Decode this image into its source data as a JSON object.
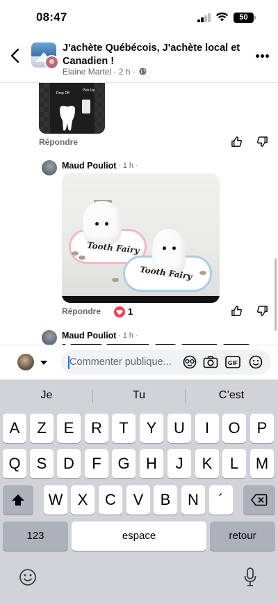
{
  "status_bar": {
    "time": "08:47",
    "battery": "50"
  },
  "header": {
    "group_title": "J'achète Québécois, J'achète local et Canadien !",
    "author": "Elaine Martel",
    "time": "2 h",
    "separator": "·"
  },
  "feed": {
    "thumb_labels": {
      "drop_off": "Drop Off",
      "pick_up": "Pick Up"
    },
    "reply_label_1": "Répondre",
    "comment_1": {
      "author": "Maud Pouliot",
      "time": "· 1 h ·",
      "photo_text_1": "Tooth Fairy",
      "photo_text_2": "Tooth Fairy",
      "reply_label": "Répondre",
      "reaction_count": "1"
    },
    "comment_2": {
      "author": "Maud Pouliot",
      "time": "· 1 h ·"
    }
  },
  "composer": {
    "placeholder": "Commenter publique..."
  },
  "keyboard": {
    "suggestions": [
      "Je",
      "Tu",
      "C’est"
    ],
    "row1": [
      "A",
      "Z",
      "E",
      "R",
      "T",
      "Y",
      "U",
      "I",
      "O",
      "P"
    ],
    "row2": [
      "Q",
      "S",
      "D",
      "F",
      "G",
      "H",
      "J",
      "K",
      "L",
      "M"
    ],
    "row3": [
      "W",
      "X",
      "C",
      "V",
      "B",
      "N",
      "´"
    ],
    "numbers_key": "123",
    "space_key": "espace",
    "return_key": "retour"
  },
  "colors": {
    "accent": "#1877f2",
    "heart": "#f33e58",
    "keyboard_bg": "#d1d3d9"
  },
  "icons": [
    "back-arrow-icon",
    "more-icon",
    "globe-icon",
    "like-icon",
    "dislike-icon",
    "heart-icon",
    "avatar-sticker-icon",
    "camera-icon",
    "gif-icon",
    "emoji-icon",
    "shift-icon",
    "backspace-icon",
    "keyboard-emoji-icon",
    "microphone-icon"
  ]
}
